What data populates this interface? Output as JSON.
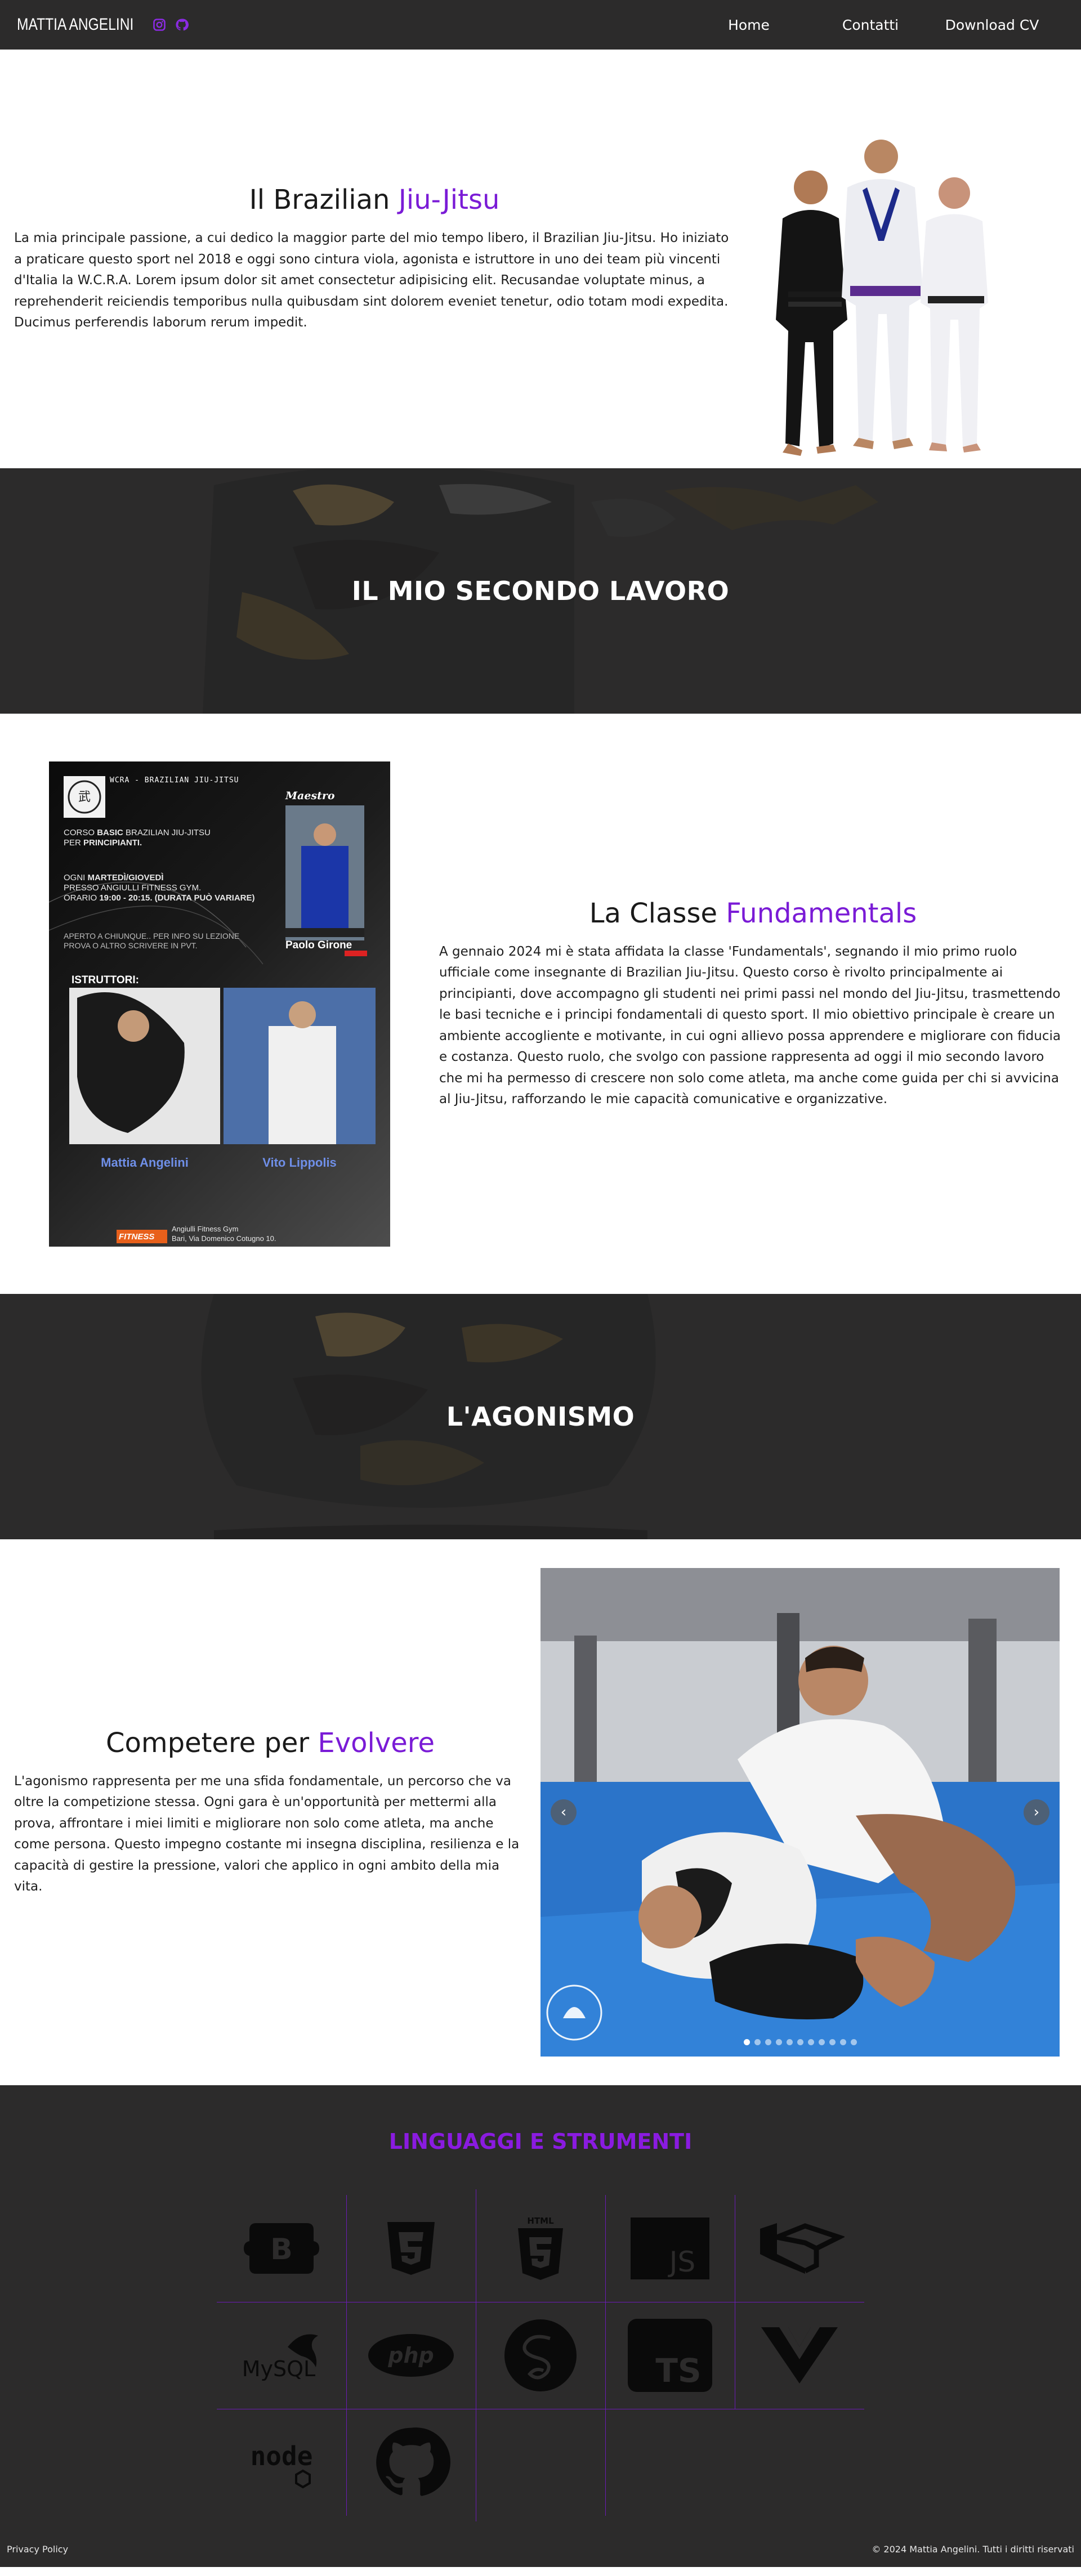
{
  "nav": {
    "brand": "MATTIA ANGELINI",
    "icons": [
      "instagram-icon",
      "github-icon"
    ],
    "links": [
      "Home",
      "Contatti",
      "Download CV"
    ],
    "accent": "#7a1bd6"
  },
  "hero": {
    "title_prefix": "Il Brazilian ",
    "title_accent": "Jiu-Jitsu",
    "body": "La mia principale passione, a cui dedico la maggior parte del mio tempo libero, il Brazilian Jiu-Jitsu. Ho iniziato a praticare questo sport nel 2018 e oggi sono cintura viola, agonista e istruttore in uno dei team più vincenti d'Italia la W.C.R.A. Lorem ipsum dolor sit amet consectetur adipisicing elit. Recusandae voluptate minus, a reprehenderit reiciendis temporibus nulla quibusdam sint dolorem eveniet tenetur, odio totam modi expedita. Ducimus perferendis laborum rerum impedit."
  },
  "banner1": {
    "title": "IL MIO SECONDO LAVORO"
  },
  "fundamentals": {
    "title_prefix": "La Classe ",
    "title_accent": "Fundamentals",
    "body": "A gennaio 2024 mi è stata affidata la classe 'Fundamentals', segnando il mio primo ruolo ufficiale come insegnante di Brazilian Jiu-Jitsu. Questo corso è rivolto principalmente ai principianti, dove accompagno gli studenti nei primi passi nel mondo del Jiu-Jitsu, trasmettendo le basi tecniche e i principi fondamentali di questo sport. Il mio obiettivo principale è creare un ambiente accogliente e motivante, in cui ogni allievo possa apprendere e migliorare con fiducia e costanza. Questo ruolo, che svolgo con passione rappresenta ad oggi il mio secondo lavoro che mi ha permesso di crescere non solo come atleta, ma anche come guida per chi si avvicina al Jiu-Jitsu, rafforzando le mie capacità comunicative e organizzative.",
    "poster": {
      "header": "WCRA - BRAZILIAN JIU-JITSU",
      "course_a": "CORSO ",
      "course_b": "BASIC",
      "course_c": " BRAZILIAN JIU-JITSU",
      "course_d": "PER ",
      "course_e": "PRINCIPIANTI.",
      "days_a": "OGNI ",
      "days_b": "MARTEDÌ/GIOVEDÌ",
      "place": "PRESSO ANGIULLI FITNESS GYM.",
      "time_a": "ORARIO ",
      "time_b": "19:00 - 20:15. (DURATA PUÒ VARIARE)",
      "open1": "APERTO A CHIUNQUE.. PER INFO SU LEZIONE",
      "open2": "PROVA O ALTRO SCRIVERE IN PVT.",
      "maestro_label": "Maestro",
      "maestro_name": "Paolo Girone",
      "instructors_label": "ISTRUTTORI:",
      "instructor1": "Mattia Angelini",
      "instructor2": "Vito Lippolis",
      "gym_logo": "FITNESS",
      "gym_name": "Angiulli Fitness Gym",
      "gym_address": "Bari, Via Domenico Cotugno 10."
    }
  },
  "banner2": {
    "title": "L'AGONISMO"
  },
  "competition": {
    "title_prefix": "Competere per ",
    "title_accent": "Evolvere",
    "body": "L'agonismo rappresenta per me una sfida fondamentale, un percorso che va oltre la competizione stessa. Ogni gara è un'opportunità per mettermi alla prova, affrontare i miei limiti e migliorare non solo come atleta, ma anche come persona. Questo impegno costante mi insegna disciplina, resilienza e la capacità di gestire la pressione, valori che applico in ogni ambito della mia vita.",
    "carousel_prev": "‹",
    "carousel_next": "›",
    "slides": 11,
    "active_slide": 1
  },
  "skills": {
    "title": "LINGUAGGI E STRUMENTI",
    "tools": [
      "bootstrap-icon",
      "css3-icon",
      "html5-icon",
      "javascript-icon",
      "laravel-icon",
      "mysql-icon",
      "php-icon",
      "sass-icon",
      "typescript-icon",
      "vue-icon",
      "nodejs-icon",
      "github-icon"
    ],
    "labels": {
      "bootstrap": "B",
      "js": "JS",
      "ts": "TS",
      "html": "HTML",
      "mysql": "MySQL",
      "php": "php",
      "node": "node"
    }
  },
  "footer": {
    "privacy": "Privacy Policy",
    "copyright": "© 2024 Mattia Angelini. Tutti i diritti riservati"
  }
}
